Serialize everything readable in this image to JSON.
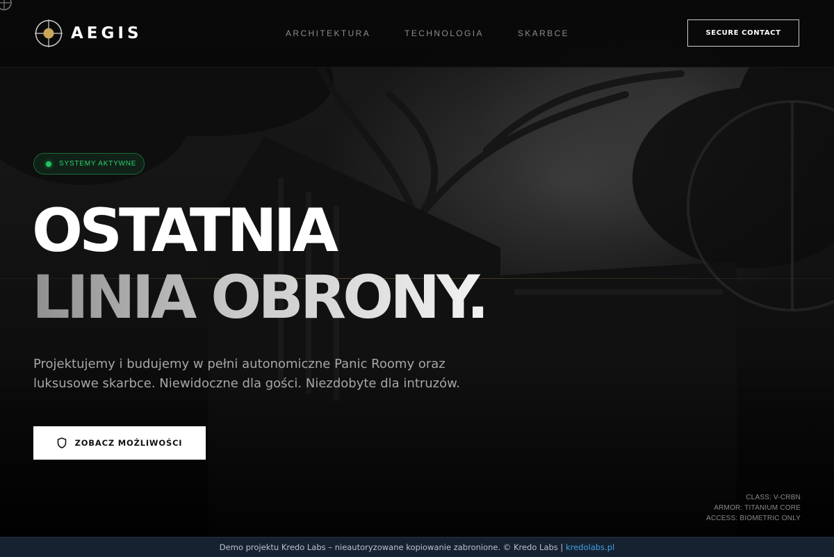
{
  "brand": {
    "name": "AEGIS",
    "logo_icon": "crosshair-gold-dot-icon"
  },
  "nav": {
    "items": [
      {
        "label": "ARCHITEKTURA"
      },
      {
        "label": "TECHNOLOGIA"
      },
      {
        "label": "SKARBCE"
      }
    ]
  },
  "header": {
    "cta_label": "SECURE CONTACT"
  },
  "hero": {
    "badge": "SYSTEMY AKTYWNE",
    "title_line1": "OSTATNIA",
    "title_line2": "LINIA OBRONY.",
    "lead_line1": "Projektujemy i budujemy w pełni autonomiczne Panic Roomy oraz",
    "lead_line2": "luksusowe skarbce. Niewidoczne dla gości. Niezdobyte dla intruzów.",
    "cta_label": "ZOBACZ MOŻLIWOŚCI",
    "cta_icon": "shield-icon"
  },
  "specs": [
    "CLASS: V-CRBN",
    "ARMOR: TITANIUM CORE",
    "ACCESS: BIOMETRIC ONLY"
  ],
  "footer": {
    "text": "Demo projektu Kredo Labs – nieautoryzowane kopiowanie zabronione. © Kredo Labs | ",
    "link_label": "kredolabs.pl"
  },
  "colors": {
    "accent_gold": "#c9a65a",
    "status_green": "#22c55e",
    "footer_bg": "#172231",
    "link_blue": "#3ea3e6"
  }
}
